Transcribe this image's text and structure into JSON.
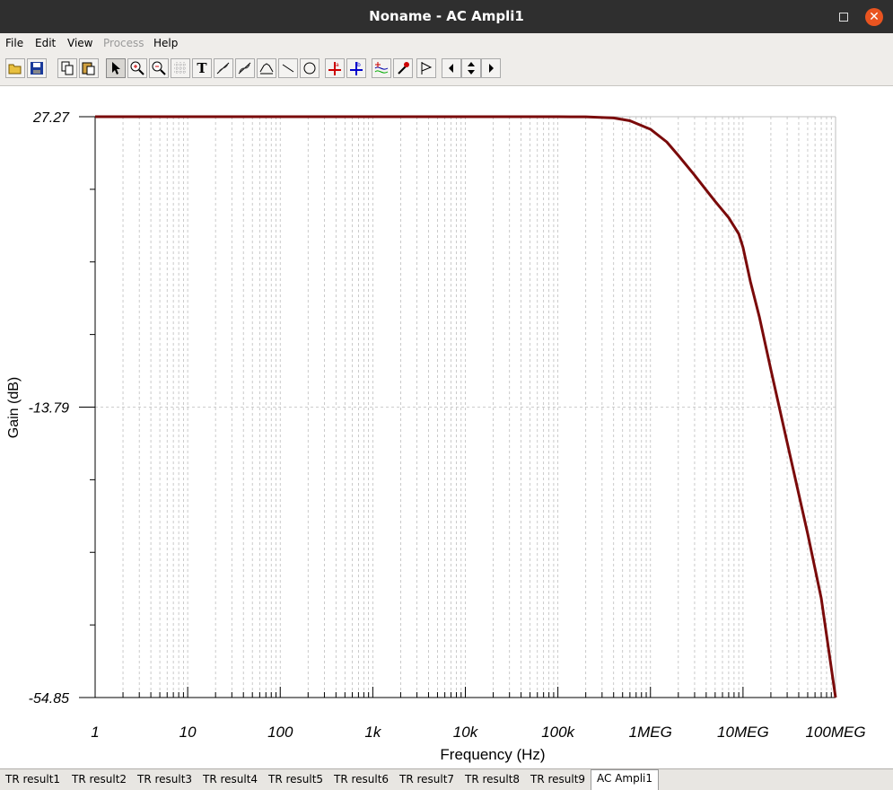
{
  "window": {
    "title": "Noname - AC Ampli1"
  },
  "menu": [
    {
      "label": "File",
      "disabled": false
    },
    {
      "label": "Edit",
      "disabled": false
    },
    {
      "label": "View",
      "disabled": false
    },
    {
      "label": "Process",
      "disabled": true
    },
    {
      "label": "Help",
      "disabled": false
    }
  ],
  "toolbar": [
    {
      "icon": "open-folder-icon"
    },
    {
      "icon": "save-icon"
    },
    {
      "icon": "copy-icon"
    },
    {
      "icon": "paste-icon"
    },
    {
      "icon": "pointer-icon",
      "active": true
    },
    {
      "icon": "zoom-in-icon"
    },
    {
      "icon": "zoom-100-icon"
    },
    {
      "icon": "grid-icon"
    },
    {
      "icon": "text-tool-icon",
      "glyph": "T"
    },
    {
      "icon": "probe-add-icon"
    },
    {
      "icon": "probe-remove-icon"
    },
    {
      "icon": "waveform-icon"
    },
    {
      "icon": "line-tool-icon"
    },
    {
      "icon": "ellipse-tool-icon"
    },
    {
      "icon": "cursor-a-icon"
    },
    {
      "icon": "cursor-b-icon"
    },
    {
      "icon": "add-trace-icon"
    },
    {
      "icon": "color-picker-icon"
    },
    {
      "icon": "flag-icon"
    },
    {
      "icon": "scroll-left-icon"
    },
    {
      "icon": "scroll-updown-icon"
    },
    {
      "icon": "scroll-right-icon"
    }
  ],
  "chart_data": {
    "type": "line",
    "title": "",
    "xlabel": "Frequency (Hz)",
    "ylabel": "Gain (dB)",
    "x_scale": "log",
    "xlim": [
      1,
      100000000
    ],
    "ylim": [
      -54.85,
      27.27
    ],
    "x_ticks": [
      {
        "value": 1,
        "label": "1"
      },
      {
        "value": 10,
        "label": "10"
      },
      {
        "value": 100,
        "label": "100"
      },
      {
        "value": 1000,
        "label": "1k"
      },
      {
        "value": 10000,
        "label": "10k"
      },
      {
        "value": 100000,
        "label": "100k"
      },
      {
        "value": 1000000,
        "label": "1MEG"
      },
      {
        "value": 10000000,
        "label": "10MEG"
      },
      {
        "value": 100000000,
        "label": "100MEG"
      }
    ],
    "y_ticks": [
      {
        "value": 27.27,
        "label": "27.27"
      },
      {
        "value": -13.79,
        "label": "-13.79"
      },
      {
        "value": -54.85,
        "label": "-54.85"
      }
    ],
    "grid": true,
    "series": [
      {
        "color": "#7a0a0a",
        "x": [
          1,
          10,
          100,
          1000,
          10000,
          100000,
          200000,
          400000,
          600000,
          1000000,
          1500000,
          2000000,
          3000000,
          4000000,
          5000000,
          7000000,
          9000000,
          10000000,
          12000000,
          15000000,
          20000000,
          30000000,
          50000000,
          70000000,
          100000000
        ],
        "y": [
          27.27,
          27.27,
          27.27,
          27.27,
          27.27,
          27.27,
          27.25,
          27.1,
          26.7,
          25.5,
          23.7,
          21.8,
          19.0,
          16.9,
          15.3,
          13.0,
          10.7,
          8.8,
          4.0,
          -1.0,
          -8.5,
          -18.8,
          -31.7,
          -40.8,
          -54.85
        ]
      }
    ]
  },
  "tabs": [
    {
      "label": "TR result1",
      "active": false
    },
    {
      "label": "TR result2",
      "active": false
    },
    {
      "label": "TR result3",
      "active": false
    },
    {
      "label": "TR result4",
      "active": false
    },
    {
      "label": "TR result5",
      "active": false
    },
    {
      "label": "TR result6",
      "active": false
    },
    {
      "label": "TR result7",
      "active": false
    },
    {
      "label": "TR result8",
      "active": false
    },
    {
      "label": "TR result9",
      "active": false
    },
    {
      "label": "AC Ampli1",
      "active": true
    }
  ]
}
